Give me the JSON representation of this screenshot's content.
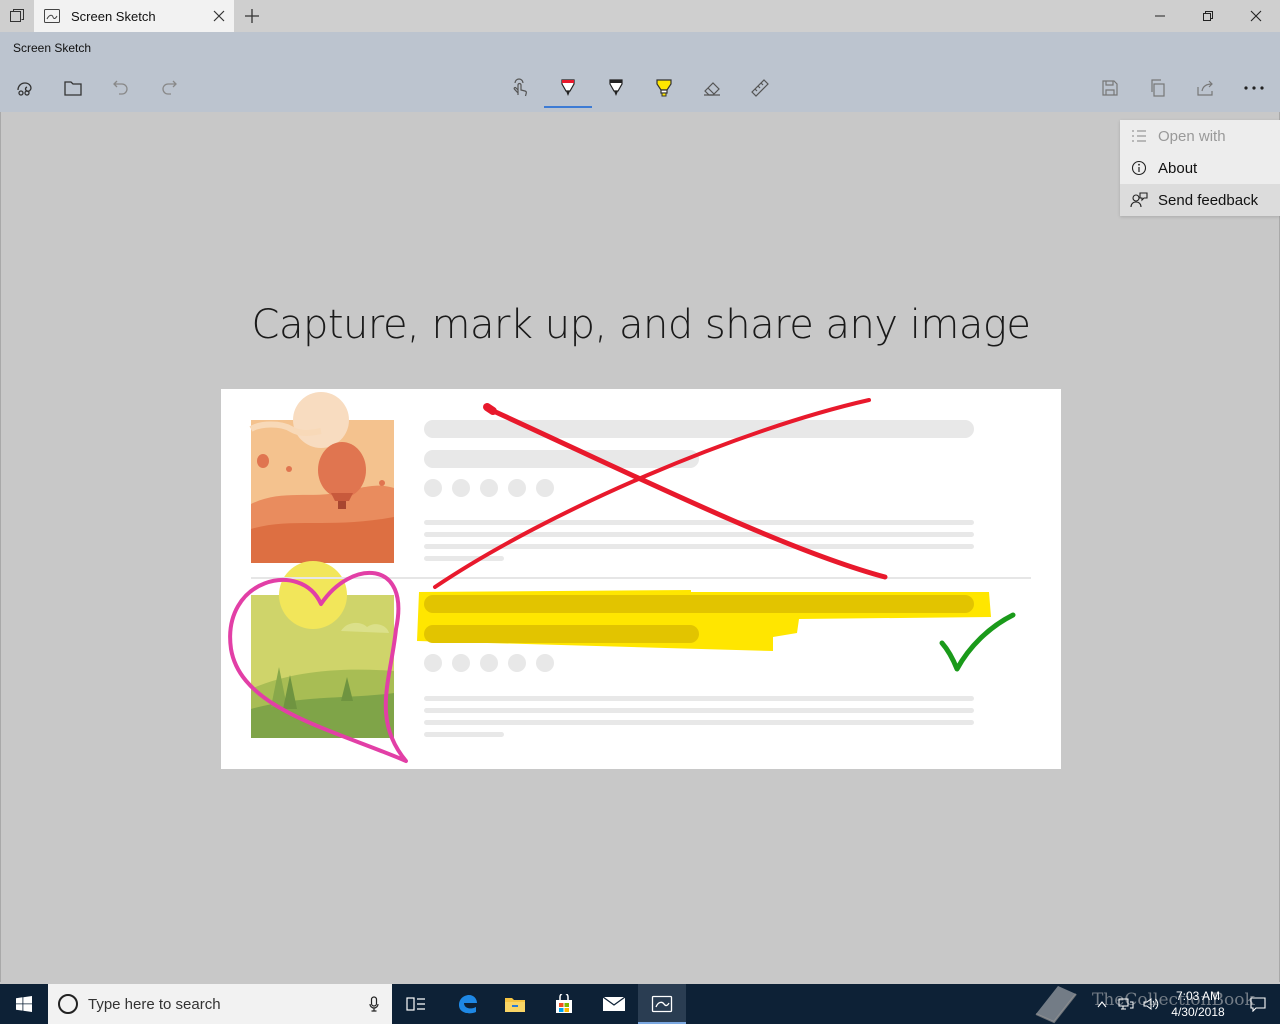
{
  "window": {
    "tab_title": "Screen Sketch",
    "app_title": "Screen Sketch"
  },
  "toolbar": {
    "left_tools": [
      "new-snip-icon",
      "open-file-icon",
      "undo-icon",
      "redo-icon"
    ],
    "center_tools": [
      "touch-writing-icon",
      "ballpoint-pen-icon",
      "pencil-icon",
      "highlighter-icon",
      "eraser-icon",
      "ruler-icon"
    ],
    "active_tool": "ballpoint-pen-icon",
    "right_tools": [
      "save-icon",
      "copy-icon",
      "share-icon",
      "more-options-icon"
    ]
  },
  "menu": {
    "items": [
      {
        "label": "Open with",
        "icon": "open-with-icon",
        "enabled": false
      },
      {
        "label": "About",
        "icon": "info-icon",
        "enabled": true
      },
      {
        "label": "Send feedback",
        "icon": "feedback-icon",
        "enabled": true
      }
    ]
  },
  "canvas": {
    "headline": "Capture, mark up, and share any image"
  },
  "colors": {
    "accent": "#3d7bd4",
    "pen_red": "#e8192c",
    "pen_pink": "#e23fa6",
    "highlighter_yellow": "#ffe600",
    "check_green": "#1a9a1a"
  },
  "taskbar": {
    "search_placeholder": "Type here to search",
    "apps": [
      "task-view-icon",
      "edge-icon",
      "file-explorer-icon",
      "store-icon",
      "mail-icon",
      "screen-sketch-icon"
    ],
    "time": "7:03 AM",
    "date": "4/30/2018",
    "watermark": "TheCollectionBook"
  }
}
